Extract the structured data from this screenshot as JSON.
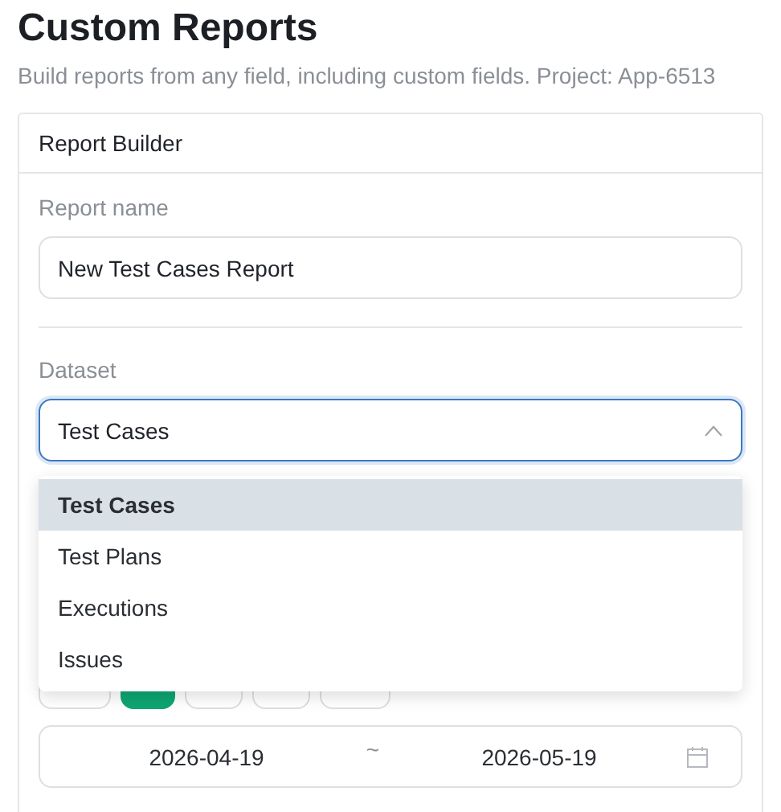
{
  "page": {
    "title": "Custom Reports",
    "subtitle": "Build reports from any field, including custom fields. Project: App-6513"
  },
  "card": {
    "title": "Report Builder"
  },
  "report_name": {
    "label": "Report name",
    "value": "New Test Cases Report"
  },
  "dataset": {
    "label": "Dataset",
    "value": "Test Cases",
    "expanded": true,
    "options": [
      {
        "label": "Test Cases",
        "selected": true
      },
      {
        "label": "Test Plans",
        "selected": false
      },
      {
        "label": "Executions",
        "selected": false
      },
      {
        "label": "Issues",
        "selected": false
      }
    ]
  },
  "range_presets": [
    {
      "selected": false
    },
    {
      "selected": true
    },
    {
      "selected": false
    },
    {
      "selected": false
    },
    {
      "selected": false
    }
  ],
  "date_range": {
    "start": "2026-04-19",
    "separator": "~",
    "end": "2026-05-19"
  }
}
